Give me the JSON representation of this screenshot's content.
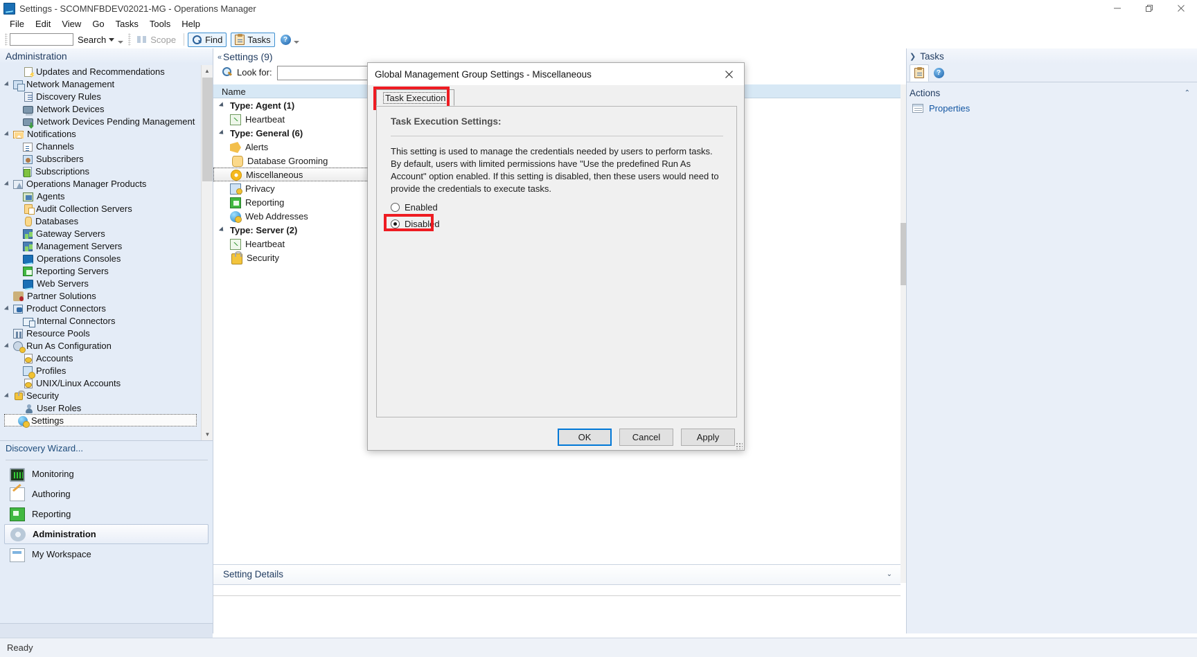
{
  "window": {
    "title": "Settings - SCOMNFBDEV02021-MG - Operations Manager",
    "app_icon": "operations-manager-icon",
    "minimize": "minimize-icon",
    "maximize": "restore-icon",
    "close": "close-icon"
  },
  "menubar": {
    "items": [
      "File",
      "Edit",
      "View",
      "Go",
      "Tasks",
      "Tools",
      "Help"
    ]
  },
  "toolbar": {
    "search_value": "",
    "search_label": "Search",
    "scope_label": "Scope",
    "find_label": "Find",
    "tasks_label": "Tasks",
    "help_label": "?"
  },
  "sidebar": {
    "header": "Administration",
    "items": [
      {
        "label": "Updates and Recommendations",
        "icon": "updates-icon",
        "indent": 2,
        "expander": "none",
        "bold": false
      },
      {
        "label": "Network Management",
        "icon": "network-management-icon",
        "indent": 1,
        "expander": "open",
        "bold": false
      },
      {
        "label": "Discovery Rules",
        "icon": "discovery-rules-icon",
        "indent": 2,
        "expander": "none",
        "bold": false
      },
      {
        "label": "Network Devices",
        "icon": "network-devices-icon",
        "indent": 2,
        "expander": "none",
        "bold": false
      },
      {
        "label": "Network Devices Pending Management",
        "icon": "network-devices-pending-icon",
        "indent": 2,
        "expander": "none",
        "bold": false
      },
      {
        "label": "Notifications",
        "icon": "notifications-icon",
        "indent": 1,
        "expander": "open",
        "bold": false
      },
      {
        "label": "Channels",
        "icon": "channels-icon",
        "indent": 2,
        "expander": "none",
        "bold": false
      },
      {
        "label": "Subscribers",
        "icon": "subscribers-icon",
        "indent": 2,
        "expander": "none",
        "bold": false
      },
      {
        "label": "Subscriptions",
        "icon": "subscriptions-icon",
        "indent": 2,
        "expander": "none",
        "bold": false
      },
      {
        "label": "Operations Manager Products",
        "icon": "operations-manager-products-icon",
        "indent": 1,
        "expander": "open",
        "bold": false
      },
      {
        "label": "Agents",
        "icon": "agents-icon",
        "indent": 2,
        "expander": "none",
        "bold": false
      },
      {
        "label": "Audit Collection Servers",
        "icon": "audit-collection-servers-icon",
        "indent": 2,
        "expander": "none",
        "bold": false
      },
      {
        "label": "Databases",
        "icon": "databases-icon",
        "indent": 2,
        "expander": "none",
        "bold": false
      },
      {
        "label": "Gateway Servers",
        "icon": "gateway-servers-icon",
        "indent": 2,
        "expander": "none",
        "bold": false
      },
      {
        "label": "Management Servers",
        "icon": "management-servers-icon",
        "indent": 2,
        "expander": "none",
        "bold": false
      },
      {
        "label": "Operations Consoles",
        "icon": "operations-consoles-icon",
        "indent": 2,
        "expander": "none",
        "bold": false
      },
      {
        "label": "Reporting Servers",
        "icon": "reporting-servers-icon",
        "indent": 2,
        "expander": "none",
        "bold": false
      },
      {
        "label": "Web Servers",
        "icon": "web-servers-icon",
        "indent": 2,
        "expander": "none",
        "bold": false
      },
      {
        "label": "Partner Solutions",
        "icon": "partner-solutions-icon",
        "indent": 1,
        "expander": "none",
        "bold": false
      },
      {
        "label": "Product Connectors",
        "icon": "product-connectors-icon",
        "indent": 1,
        "expander": "open",
        "bold": false
      },
      {
        "label": "Internal Connectors",
        "icon": "internal-connectors-icon",
        "indent": 2,
        "expander": "none",
        "bold": false
      },
      {
        "label": "Resource Pools",
        "icon": "resource-pools-icon",
        "indent": 1,
        "expander": "none",
        "bold": false
      },
      {
        "label": "Run As Configuration",
        "icon": "run-as-configuration-icon",
        "indent": 1,
        "expander": "open",
        "bold": false
      },
      {
        "label": "Accounts",
        "icon": "accounts-icon",
        "indent": 2,
        "expander": "none",
        "bold": false
      },
      {
        "label": "Profiles",
        "icon": "profiles-icon",
        "indent": 2,
        "expander": "none",
        "bold": false
      },
      {
        "label": "UNIX/Linux Accounts",
        "icon": "unix-linux-accounts-icon",
        "indent": 2,
        "expander": "none",
        "bold": false
      },
      {
        "label": "Security",
        "icon": "security-icon",
        "indent": 1,
        "expander": "open",
        "bold": false
      },
      {
        "label": "User Roles",
        "icon": "user-roles-icon",
        "indent": 2,
        "expander": "none",
        "bold": false
      },
      {
        "label": "Settings",
        "icon": "settings-icon",
        "indent": 1,
        "expander": "none",
        "bold": false,
        "selected": true
      }
    ],
    "discovery_wizard": "Discovery Wizard...",
    "nav_buttons": [
      {
        "label": "Monitoring",
        "icon": "monitoring-icon",
        "active": false
      },
      {
        "label": "Authoring",
        "icon": "authoring-icon",
        "active": false
      },
      {
        "label": "Reporting",
        "icon": "reporting-icon",
        "active": false
      },
      {
        "label": "Administration",
        "icon": "administration-icon",
        "active": true
      },
      {
        "label": "My Workspace",
        "icon": "my-workspace-icon",
        "active": false
      }
    ]
  },
  "middle": {
    "title": "Settings (9)",
    "lookfor_label": "Look for:",
    "lookfor_value": "",
    "lookfor_placeholder": "",
    "column_header": "Name",
    "rows": [
      {
        "label": "Type: Agent (1)",
        "kind": "group",
        "icon": "expander-icon"
      },
      {
        "label": "Heartbeat",
        "kind": "item",
        "icon": "heartbeat-icon"
      },
      {
        "label": "Type: General (6)",
        "kind": "group",
        "icon": "expander-icon"
      },
      {
        "label": "Alerts",
        "kind": "item",
        "icon": "alerts-icon"
      },
      {
        "label": "Database Grooming",
        "kind": "item",
        "icon": "database-grooming-icon"
      },
      {
        "label": "Miscellaneous",
        "kind": "item",
        "icon": "miscellaneous-icon",
        "selected": true
      },
      {
        "label": "Privacy",
        "kind": "item",
        "icon": "privacy-icon"
      },
      {
        "label": "Reporting",
        "kind": "item",
        "icon": "reporting-icon"
      },
      {
        "label": "Web Addresses",
        "kind": "item",
        "icon": "web-addresses-icon"
      },
      {
        "label": "Type: Server (2)",
        "kind": "group",
        "icon": "expander-icon"
      },
      {
        "label": "Heartbeat",
        "kind": "item",
        "icon": "heartbeat-icon"
      },
      {
        "label": "Security",
        "kind": "item",
        "icon": "security-lock-icon"
      }
    ],
    "details_bar_title": "Setting Details"
  },
  "right": {
    "tasks_label": "Tasks",
    "tab_tasks_icon": "clipboard-tasks-icon",
    "tab_help_icon": "help-icon",
    "actions_header": "Actions",
    "actions": [
      {
        "label": "Properties",
        "icon": "properties-icon"
      }
    ]
  },
  "dialog": {
    "title": "Global Management Group Settings - Miscellaneous",
    "close_icon": "close-icon",
    "tab_label": "Task Execution",
    "panel_heading": "Task Execution Settings:",
    "description": "This setting is used to manage the credentials needed by users to perform tasks. By default, users with limited permissions have \"Use the predefined Run As Account\" option enabled. If this setting is disabled, then these users would need to provide the credentials to execute tasks.",
    "radio_enabled": "Enabled",
    "radio_disabled": "Disabled",
    "selected_option": "Disabled",
    "buttons": {
      "ok": "OK",
      "cancel": "Cancel",
      "apply": "Apply"
    },
    "highlight_color": "#ee1c22"
  },
  "statusbar": {
    "text": "Ready"
  }
}
